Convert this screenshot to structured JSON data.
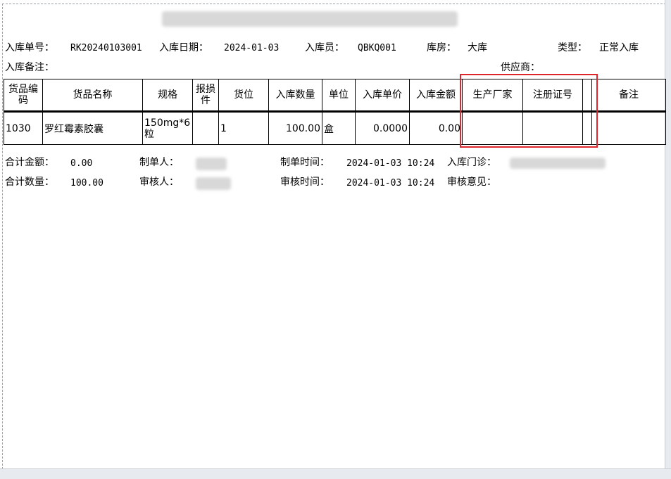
{
  "header": {
    "inbound_no_label": "入库单号：",
    "inbound_no": "RK20240103001",
    "inbound_date_label": "入库日期：",
    "inbound_date": "2024-01-03",
    "clerk_label": "入库员：",
    "clerk": "QBKQ001",
    "warehouse_label": "库房：",
    "warehouse": "大库",
    "type_label": "类型：",
    "type": "正常入库",
    "remark_label": "入库备注：",
    "supplier_label": "供应商："
  },
  "table": {
    "headers": [
      "货品编码",
      "货品名称",
      "规格",
      "报损件",
      "货位",
      "入库数量",
      "单位",
      "入库单价",
      "入库金额",
      "生产厂家",
      "注册证号",
      "",
      "备注"
    ],
    "row": {
      "code": "1030",
      "name": "罗红霉素胶囊",
      "spec": "150mg*6粒",
      "loss": "",
      "location": "1",
      "qty": "100.00",
      "unit": "盒",
      "price": "0.0000",
      "amount": "0.00",
      "manufacturer": "",
      "reg_no": "",
      "blank": "",
      "note": ""
    }
  },
  "footer": {
    "total_amount_label": "合计金额：",
    "total_amount": "0.00",
    "total_qty_label": "合计数量：",
    "total_qty": "100.00",
    "maker_label": "制单人：",
    "auditor_label": "审核人：",
    "make_time_label": "制单时间：",
    "make_time": "2024-01-03 10:24",
    "audit_time_label": "审核时间：",
    "audit_time": "2024-01-03 10:24",
    "clinic_label": "入库门诊：",
    "audit_opinion_label": "审核意见："
  },
  "colors": {
    "highlight": "#e0242c"
  }
}
